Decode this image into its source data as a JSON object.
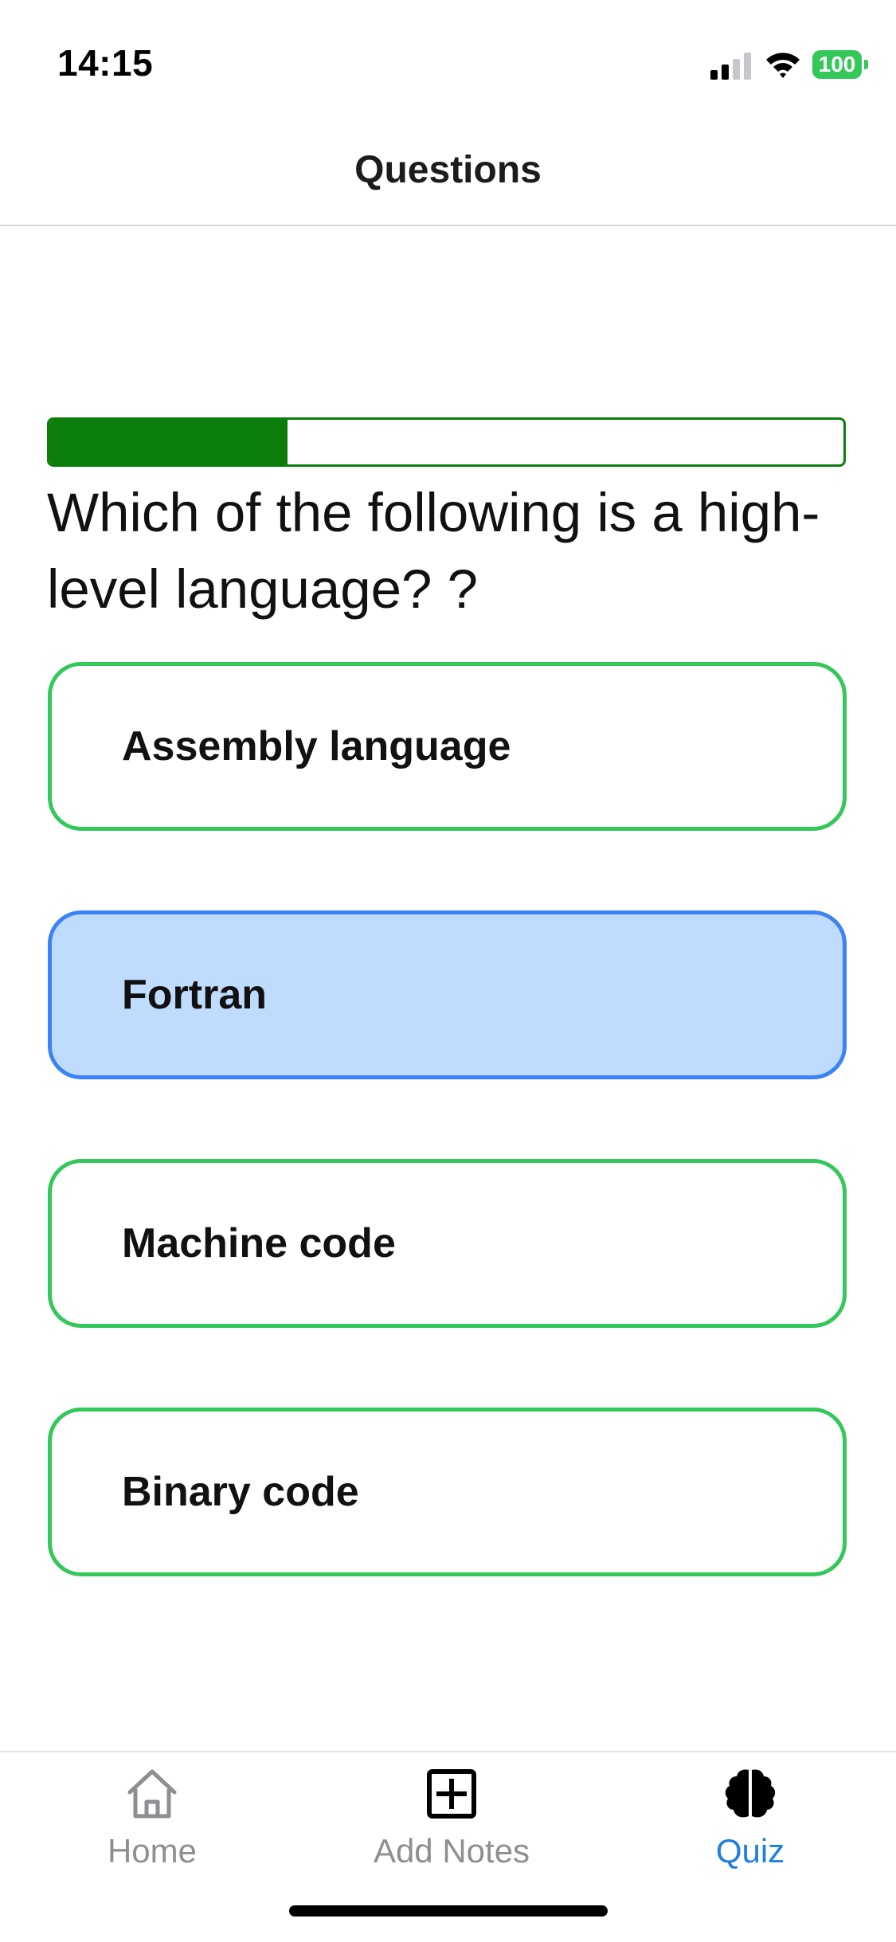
{
  "status_bar": {
    "time": "14:15",
    "battery_level": "100",
    "battery_color": "#34c759",
    "icons": [
      "signal-icon",
      "wifi-icon",
      "battery-icon"
    ]
  },
  "header": {
    "title": "Questions"
  },
  "quiz": {
    "progress_fraction": 0.3,
    "progress_color": "#0a7d0a",
    "question": "Which of the following is a high-level language? ?",
    "options": [
      {
        "label": "Assembly language",
        "selected": false
      },
      {
        "label": "Fortran",
        "selected": true
      },
      {
        "label": "Machine code",
        "selected": false
      },
      {
        "label": "Binary code",
        "selected": false
      }
    ],
    "option_border_color": "#34c759",
    "selected_border_color": "#3b82f6",
    "selected_fill_color": "#bfdbfd"
  },
  "tab_bar": {
    "tabs": [
      {
        "label": "Home",
        "icon": "home-icon",
        "active": false
      },
      {
        "label": "Add Notes",
        "icon": "plus-square-icon",
        "active": false
      },
      {
        "label": "Quiz",
        "icon": "brain-icon",
        "active": true
      }
    ],
    "active_color": "#1e7fe0",
    "inactive_color": "#8e8e93"
  }
}
